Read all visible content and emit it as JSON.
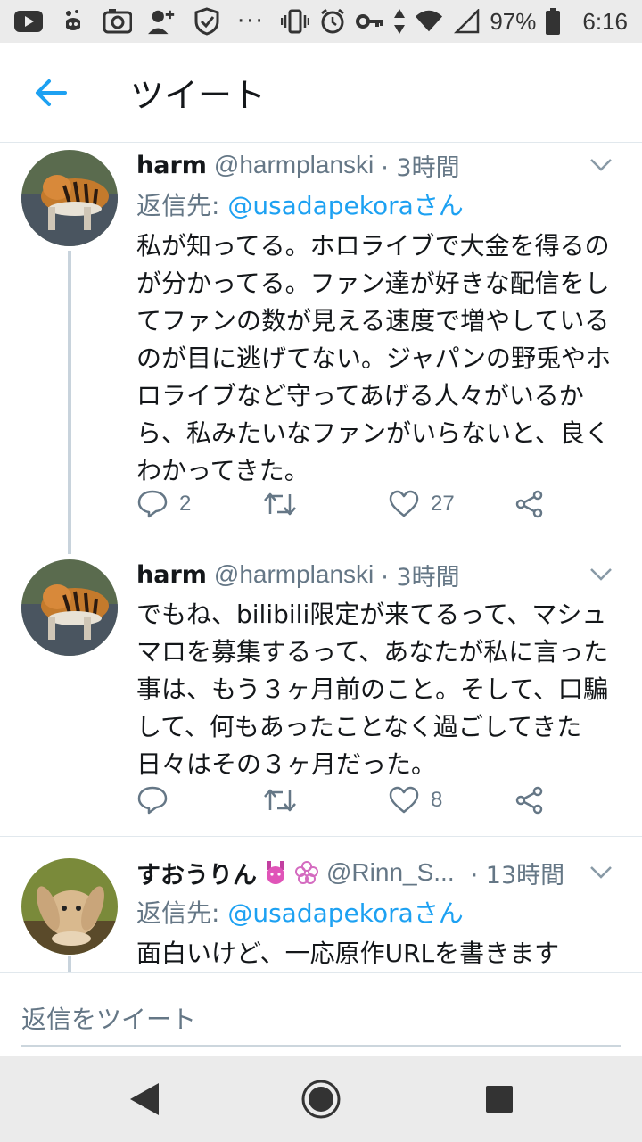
{
  "status_bar": {
    "battery": "97%",
    "time": "6:16",
    "dots": "···"
  },
  "header": {
    "title": "ツイート"
  },
  "tweets": [
    {
      "name": "harm",
      "handle": "@harmplanski",
      "time": "· 3時間",
      "reply_label": "返信先: ",
      "reply_to": "@usadapekoraさん",
      "body": "私が知ってる。ホロライブで大金を得るのが分かってる。ファン達が好きな配信をしてファンの数が見える速度で増やしているのが目に逃げてない。ジャパンの野兎やホロライブなど守ってあげる人々がいるから、私みたいなファンがいらないと、良くわかってきた。",
      "replies": "2",
      "retweets": "",
      "likes": "27"
    },
    {
      "name": "harm",
      "handle": "@harmplanski",
      "time": "· 3時間",
      "body": "でもね、bilibili限定が来てるって、マシュマロを募集するって、あなたが私に言った事は、もう３ヶ月前のこと。そして、口騙して、何もあったことなく過ごしてきた日々はその３ヶ月だった。",
      "replies": "",
      "retweets": "",
      "likes": "8"
    },
    {
      "name": "すおうりん",
      "handle": "@Rinn_S...",
      "time": "· 13時間",
      "reply_label": "返信先: ",
      "reply_to": "@usadapekoraさん",
      "body": "面白いけど、一応原作URLを書きます"
    }
  ],
  "compose": {
    "placeholder": "返信をツイート"
  },
  "colors": {
    "accent": "#1da1f2",
    "secondary_text": "#657786",
    "thread_line": "#c8d3dc"
  }
}
